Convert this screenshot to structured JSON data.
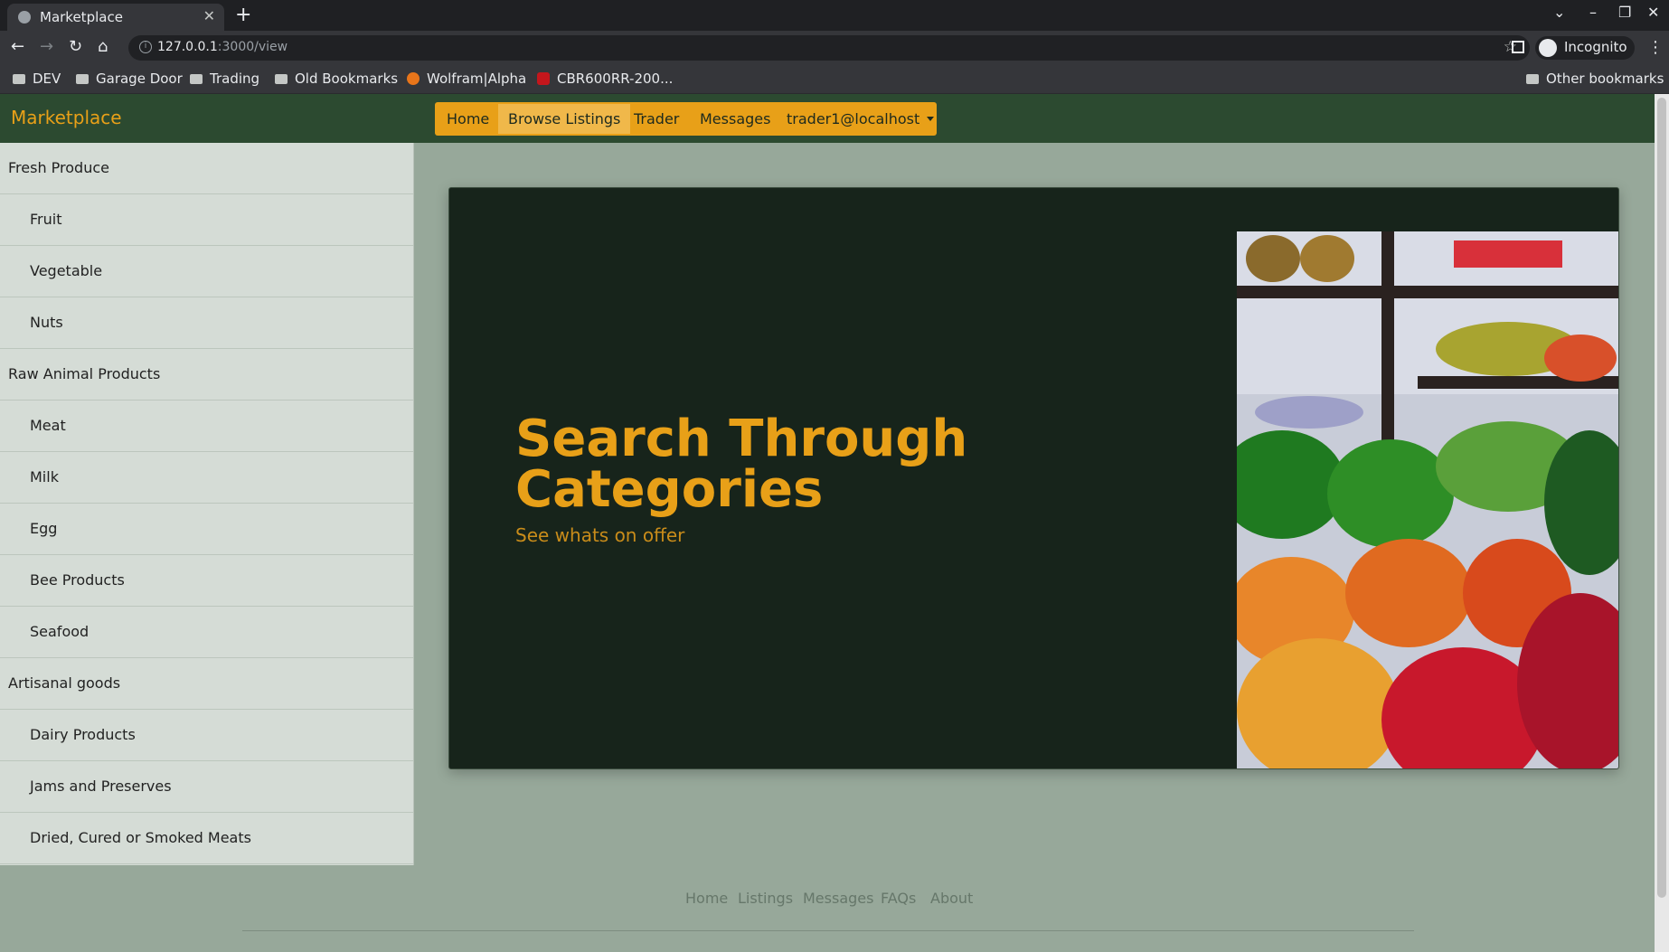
{
  "browser": {
    "tab_title": "Marketplace",
    "new_tab_icon": "plus-icon",
    "url_host": "127.0.0.1",
    "url_path": ":3000/view",
    "profile_label": "Incognito",
    "bookmarks": [
      {
        "label": "DEV",
        "icon": "folder-icon"
      },
      {
        "label": "Garage Door",
        "icon": "folder-icon"
      },
      {
        "label": "Trading",
        "icon": "folder-icon"
      },
      {
        "label": "Old Bookmarks",
        "icon": "folder-icon"
      },
      {
        "label": "Wolfram|Alpha",
        "icon": "wolfram-icon"
      },
      {
        "label": "CBR600RR-200...",
        "icon": "honda-icon"
      }
    ],
    "other_bookmarks": "Other bookmarks"
  },
  "site": {
    "brand": "Marketplace",
    "menu": {
      "home": "Home",
      "browse": "Browse Listings",
      "trader": "Trader",
      "messages": "Messages",
      "user": "trader1@localhost"
    }
  },
  "sidebar": {
    "items": [
      {
        "label": "Fresh Produce",
        "level": "category"
      },
      {
        "label": "Fruit",
        "level": "sub"
      },
      {
        "label": "Vegetable",
        "level": "sub"
      },
      {
        "label": "Nuts",
        "level": "sub"
      },
      {
        "label": "Raw Animal Products",
        "level": "category"
      },
      {
        "label": "Meat",
        "level": "sub"
      },
      {
        "label": "Milk",
        "level": "sub"
      },
      {
        "label": "Egg",
        "level": "sub"
      },
      {
        "label": "Bee Products",
        "level": "sub"
      },
      {
        "label": "Seafood",
        "level": "sub"
      },
      {
        "label": "Artisanal goods",
        "level": "category"
      },
      {
        "label": "Dairy Products",
        "level": "sub"
      },
      {
        "label": "Jams and Preserves",
        "level": "sub"
      },
      {
        "label": "Dried, Cured or Smoked Meats",
        "level": "sub"
      }
    ]
  },
  "hero": {
    "title": "Search Through Categories",
    "subtitle": "See whats on offer"
  },
  "footer": {
    "links": [
      "Home",
      "Listings",
      "Messages",
      "FAQs",
      "About"
    ]
  },
  "colors": {
    "accent": "#e8a018",
    "nav_bg": "#2c4a30",
    "hero_bg": "#17241b",
    "page_bg": "#97a89a"
  }
}
